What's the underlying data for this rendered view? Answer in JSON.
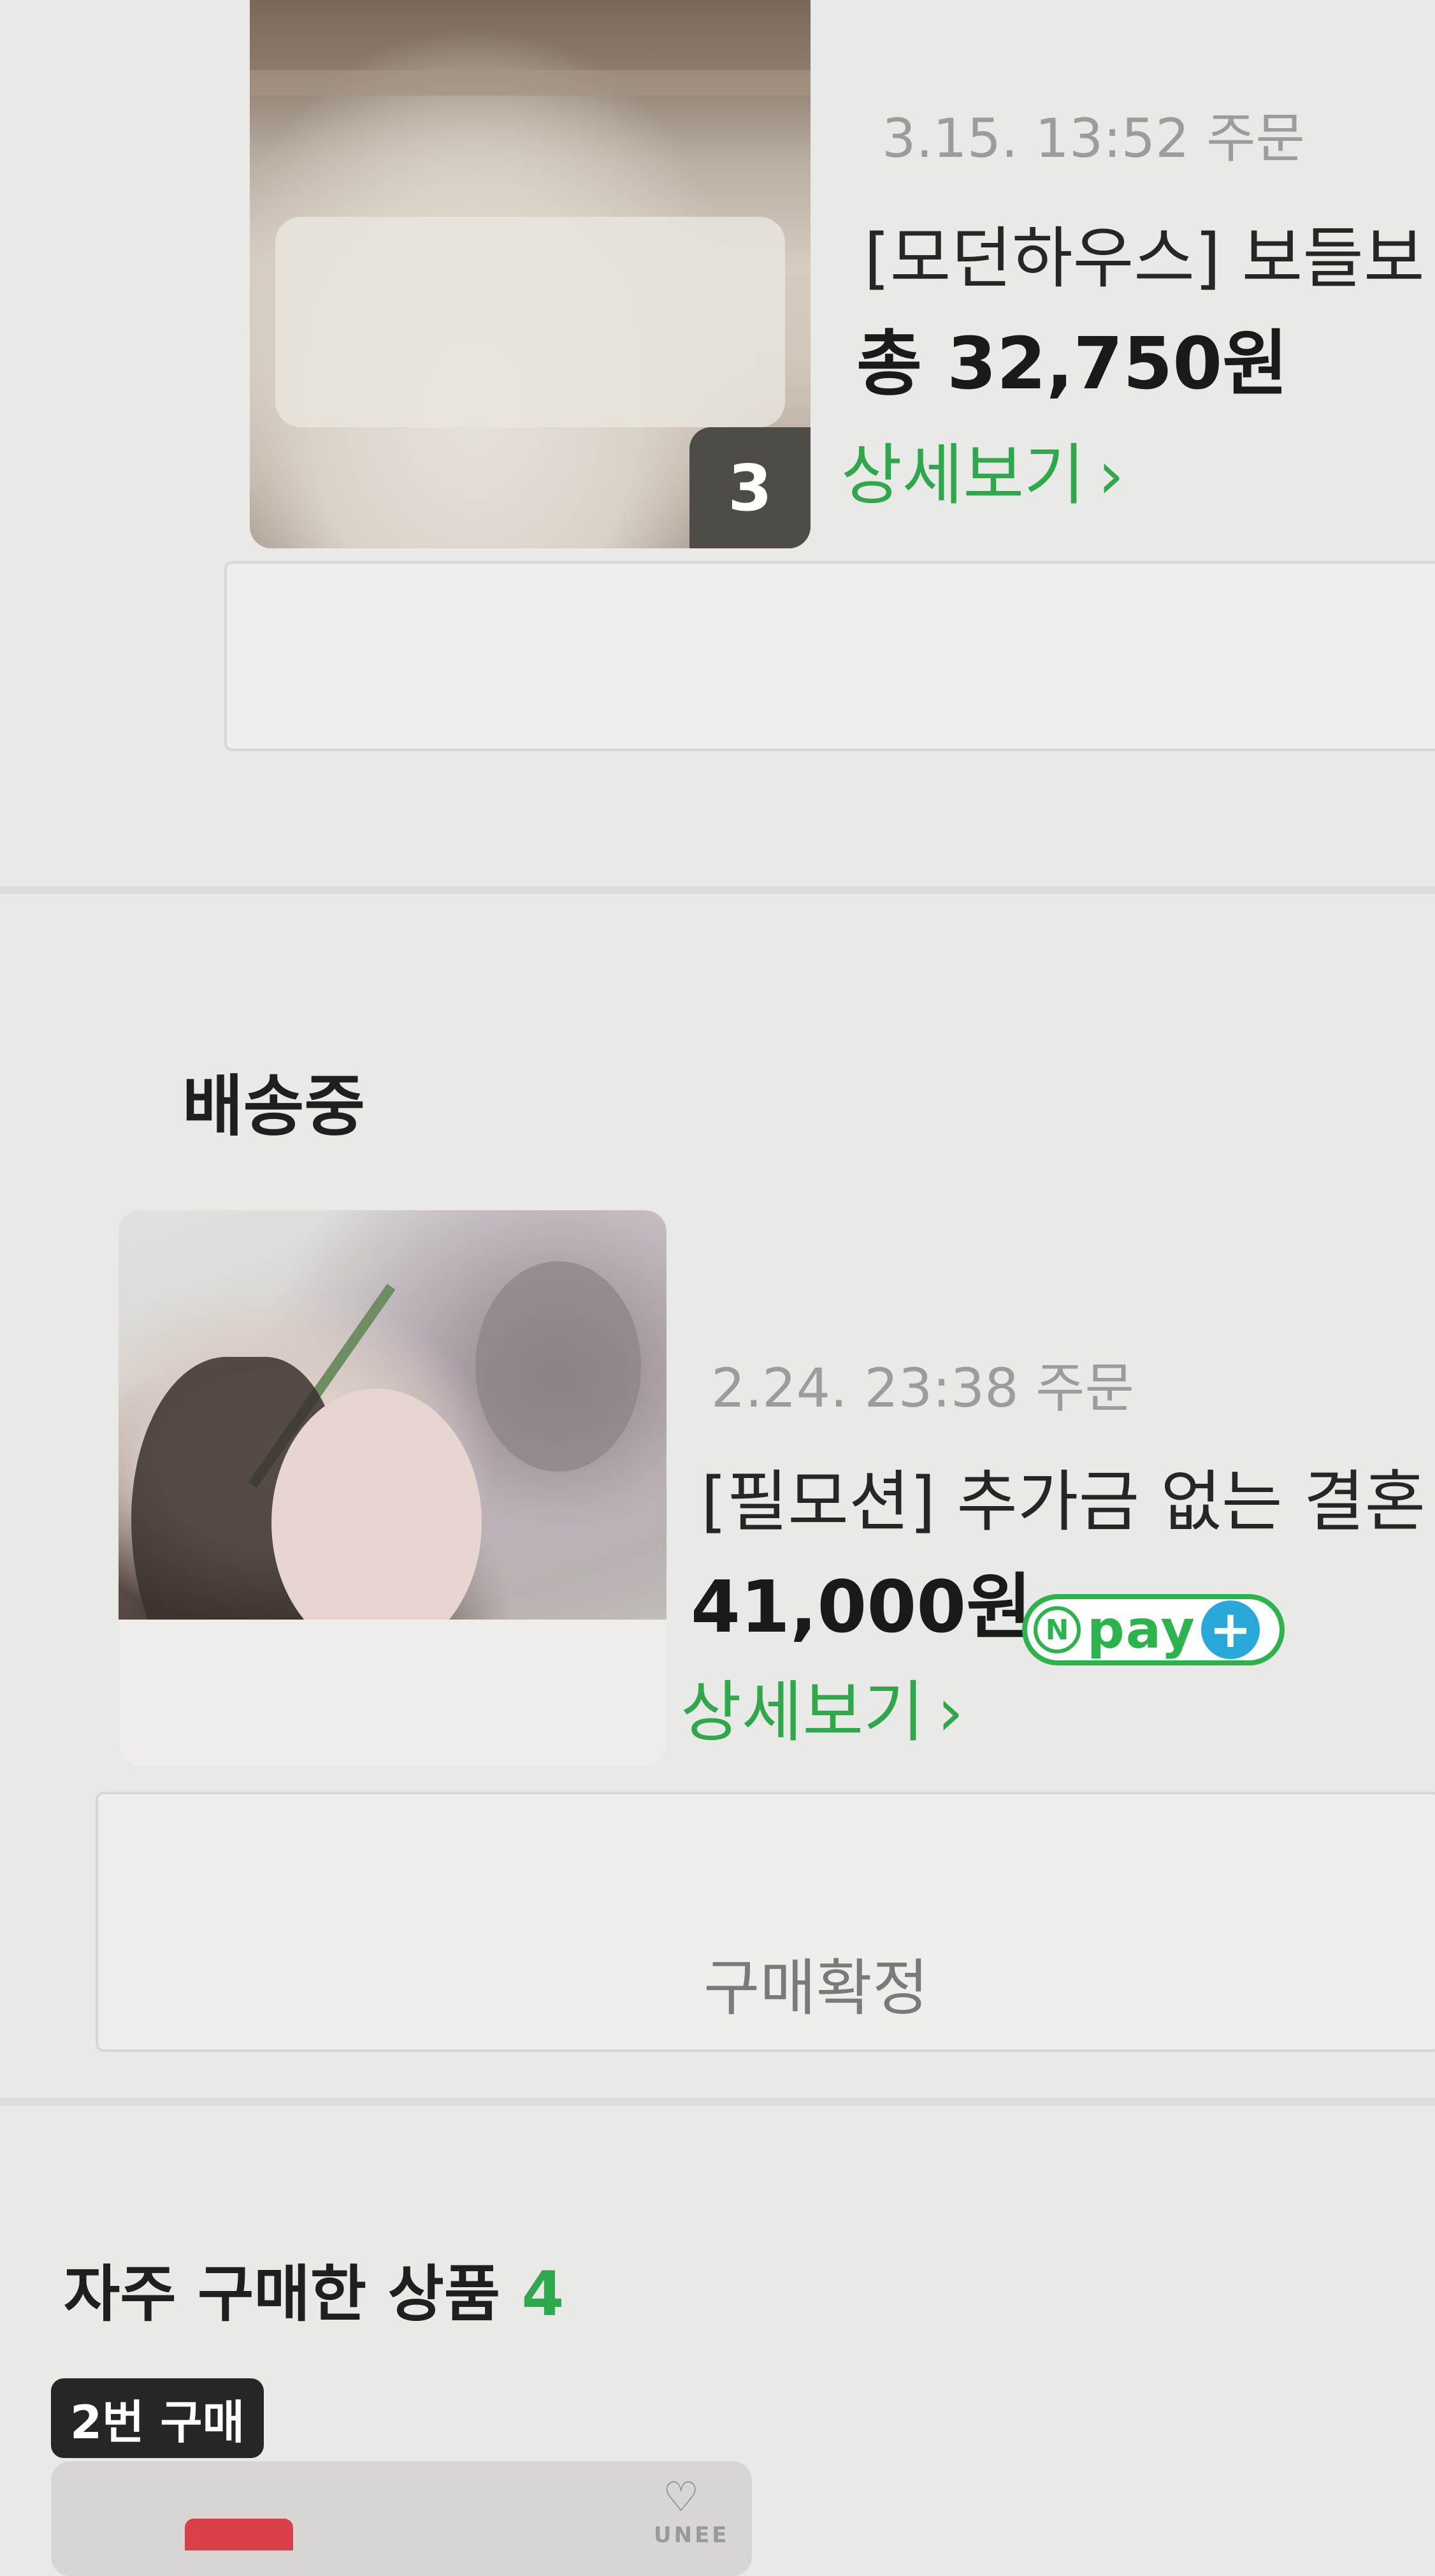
{
  "orders": [
    {
      "date": "3.15. 13:52 주문",
      "title": "[모던하우스] 보들보",
      "price": "총 32,750원",
      "detail_label": "상세보기",
      "chevron": "›",
      "item_count": "3",
      "thumbnail_icon": "bedding-photo"
    },
    {
      "section": "배송중",
      "date": "2.24. 23:38 주문",
      "title": "[필모션] 추가금 없는 결혼",
      "price": "41,000원",
      "detail_label": "상세보기",
      "chevron": "›",
      "confirm_label": "구매확정",
      "thumbnail_icon": "portrait-photo",
      "npay": {
        "n": "N",
        "pay": "pay",
        "plus": "+"
      }
    }
  ],
  "frequent": {
    "title": "자주 구매한 상품",
    "count": "4",
    "badge": "2번 구매",
    "brand_text": "UNEE",
    "brand_icon": "heart-logo-icon"
  },
  "colors": {
    "accent_green": "#2ea84a",
    "npay_green": "#2bb34c",
    "npay_plus_blue": "#28a8d8",
    "background": "#e9e9e7"
  }
}
